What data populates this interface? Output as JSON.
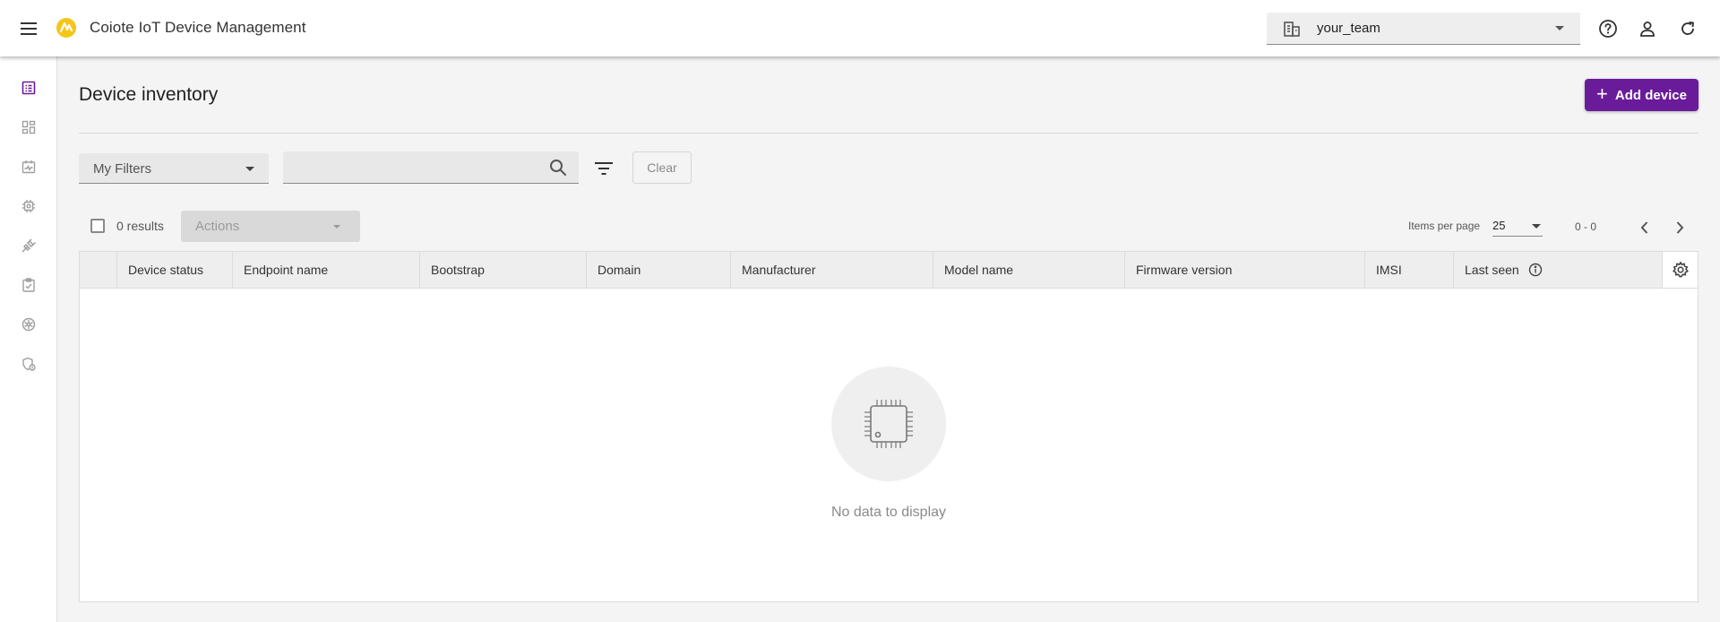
{
  "header": {
    "app_title": "Coiote IoT Device Management",
    "team": "your_team",
    "icons": [
      "menu-icon",
      "help-icon",
      "account-icon",
      "refresh-icon"
    ]
  },
  "sidebar": {
    "active_color": "#6a1b9a",
    "items": [
      {
        "icon": "device-inventory-icon",
        "active": true
      },
      {
        "icon": "dashboard-icon",
        "active": false
      },
      {
        "icon": "monitoring-icon",
        "active": false
      },
      {
        "icon": "chip-icon",
        "active": false
      },
      {
        "icon": "integrations-icon",
        "active": false
      },
      {
        "icon": "tasks-icon",
        "active": false
      },
      {
        "icon": "settings-wheel-icon",
        "active": false
      },
      {
        "icon": "security-icon",
        "active": false
      }
    ]
  },
  "main": {
    "title": "Device inventory",
    "add_button": "Add device",
    "filters_label": "My Filters",
    "search_value": "",
    "clear_label": "Clear",
    "results": "0 results",
    "actions_label": "Actions",
    "items_per_page_label": "Items per page",
    "items_per_page": "25",
    "range": "0 - 0",
    "columns": [
      "Device status",
      "Endpoint name",
      "Bootstrap",
      "Domain",
      "Manufacturer",
      "Model name",
      "Firmware version",
      "IMSI",
      "Last seen"
    ],
    "empty_text": "No data to display"
  },
  "colors": {
    "primary": "#6a1b9a",
    "logo": "#f5c518"
  }
}
